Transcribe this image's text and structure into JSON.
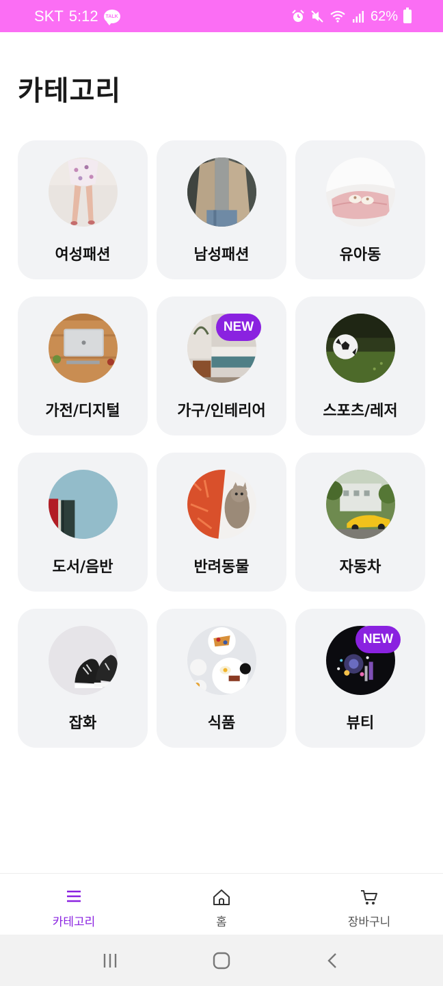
{
  "status_bar": {
    "carrier": "SKT",
    "time": "5:12",
    "talk_badge": "TALK",
    "battery": "62%"
  },
  "page_title": "카테고리",
  "categories": [
    {
      "label": "여성패션"
    },
    {
      "label": "남성패션"
    },
    {
      "label": "유아동"
    },
    {
      "label": "가전/디지털"
    },
    {
      "label": "가구/인테리어",
      "badge": "NEW"
    },
    {
      "label": "스포츠/레저"
    },
    {
      "label": "도서/음반"
    },
    {
      "label": "반려동물"
    },
    {
      "label": "자동차"
    },
    {
      "label": "잡화"
    },
    {
      "label": "식품"
    },
    {
      "label": "뷰티",
      "badge": "NEW"
    }
  ],
  "bottom_nav": {
    "items": [
      {
        "label": "카테고리",
        "icon": "menu-icon",
        "active": true
      },
      {
        "label": "홈",
        "icon": "home-icon"
      },
      {
        "label": "장바구니",
        "icon": "cart-icon"
      }
    ]
  },
  "colors": {
    "accent": "#8a22e0",
    "status_bar": "#fb6ef4",
    "card_bg": "#f2f3f5"
  }
}
